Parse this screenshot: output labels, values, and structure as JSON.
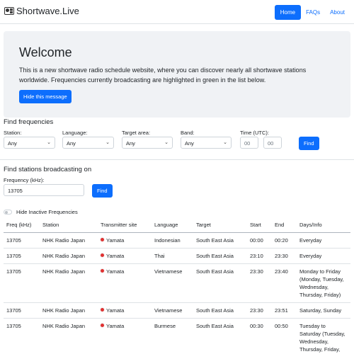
{
  "nav": {
    "brand": "Shortwave.Live",
    "links": [
      "Home",
      "FAQs",
      "About"
    ]
  },
  "welcome": {
    "title": "Welcome",
    "text": "This is a new shortwave radio schedule website, where you can discover nearly all shortwave stations worldwide. Frequencies currently broadcasting are highlighted in green in the list below.",
    "hide_button": "Hide this message"
  },
  "find_frequencies": {
    "title": "Find frequencies",
    "station_label": "Station:",
    "station_value": "Any",
    "language_label": "Language:",
    "language_value": "Any",
    "target_label": "Target area:",
    "target_value": "Any",
    "band_label": "Band:",
    "band_value": "Any",
    "time_label": "Time (UTC):",
    "time_hour_placeholder": "00",
    "time_min_placeholder": "00",
    "find_button": "Find"
  },
  "find_stations": {
    "title": "Find stations broadcasting on",
    "freq_label": "Frequency (kHz):",
    "freq_value": "13705",
    "find_button": "Find"
  },
  "toggle": {
    "label": "Hide Inactive Frequencies"
  },
  "table": {
    "headers": [
      "Freq (kHz)",
      "Station",
      "Transmitter site",
      "Language",
      "Target",
      "Start",
      "End",
      "Days/Info"
    ],
    "rows": [
      [
        "13705",
        "NHK Radio Japan",
        "Yamata",
        "Indonesian",
        "South East Asia",
        "00:00",
        "00:20",
        "Everyday"
      ],
      [
        "13705",
        "NHK Radio Japan",
        "Yamata",
        "Thai",
        "South East Asia",
        "23:10",
        "23:30",
        "Everyday"
      ],
      [
        "13705",
        "NHK Radio Japan",
        "Yamata",
        "Vietnamese",
        "South East Asia",
        "23:30",
        "23:40",
        "Monday to Friday (Monday, Tuesday, Wednesday, Thursday, Friday)"
      ],
      [
        "13705",
        "NHK Radio Japan",
        "Yamata",
        "Vietnamese",
        "South East Asia",
        "23:30",
        "23:51",
        "Saturday, Sunday"
      ],
      [
        "13705",
        "NHK Radio Japan",
        "Yamata",
        "Burmese",
        "South East Asia",
        "00:30",
        "00:50",
        "Tuesday to Saturday (Tuesday, Wednesday, Thursday, Friday, Saturday)"
      ]
    ]
  },
  "colors": {
    "primary": "#0d6efd",
    "welcome_bg": "#f0f2f5",
    "flag": "#e03131"
  }
}
